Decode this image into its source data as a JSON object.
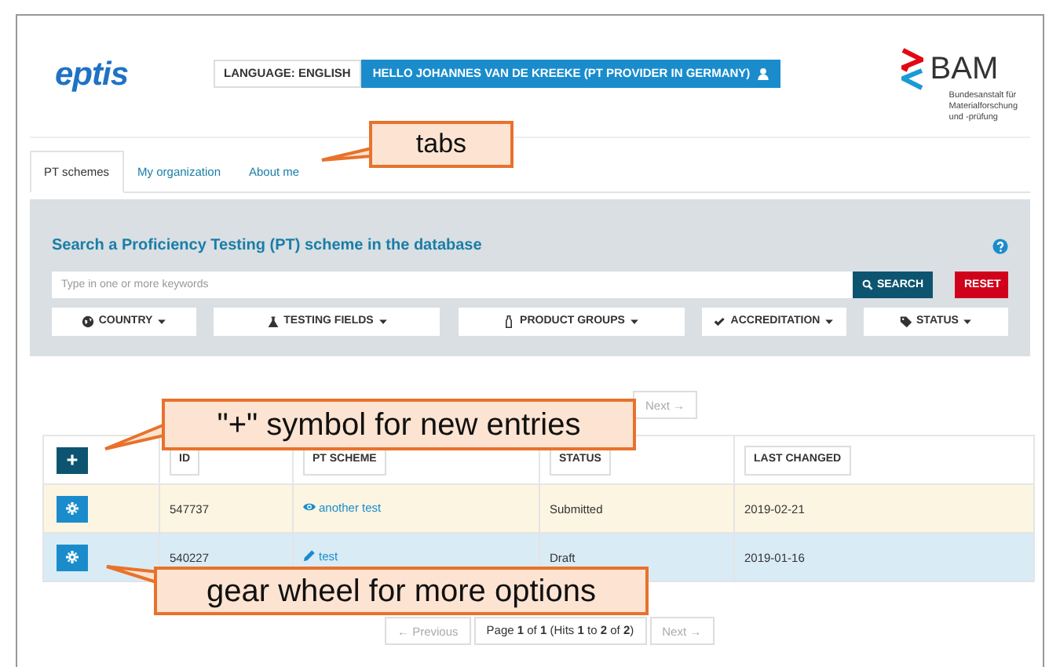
{
  "logo": {
    "text": "eptis"
  },
  "header": {
    "language": "LANGUAGE: ENGLISH",
    "user": "HELLO JOHANNES VAN DE KREEKE (PT PROVIDER IN GERMANY)"
  },
  "org_logo": {
    "name": "BAM",
    "subtitle": [
      "Bundesanstalt für",
      "Materialforschung",
      "und -prüfung"
    ]
  },
  "tabs": [
    {
      "label": "PT schemes",
      "selected": true
    },
    {
      "label": "My organization",
      "selected": false
    },
    {
      "label": "About me",
      "selected": false
    }
  ],
  "search": {
    "title": "Search a Proficiency Testing (PT) scheme in the database",
    "placeholder": "Type in one or more keywords",
    "search_button": "SEARCH",
    "reset_button": "RESET"
  },
  "filters": [
    {
      "label": "COUNTRY"
    },
    {
      "label": "TESTING FIELDS"
    },
    {
      "label": "PRODUCT GROUPS"
    },
    {
      "label": "ACCREDITATION"
    },
    {
      "label": "STATUS"
    }
  ],
  "top_pagination": {
    "next": "Next →",
    "disabled": true
  },
  "table": {
    "columns": [
      "ID",
      "PT SCHEME",
      "STATUS",
      "LAST CHANGED"
    ],
    "rows": [
      {
        "id": "547737",
        "scheme": "another test",
        "kind": "view",
        "status": "Submitted",
        "last_changed": "2019-02-21",
        "color": "#fbf5e2"
      },
      {
        "id": "540227",
        "scheme": "test",
        "kind": "edit",
        "status": "Draft",
        "last_changed": "2019-01-16",
        "color": "#d9ebf5"
      }
    ]
  },
  "bottom_pagination": {
    "previous": "← Previous",
    "page": "Page **1** of **1** (Hits **1** to **2** of **2**)",
    "next": "Next →",
    "disabled": true
  },
  "callouts": [
    {
      "text": "tabs"
    },
    {
      "text": "\"+\" symbol for new entries"
    },
    {
      "text": "gear wheel for more options"
    }
  ]
}
